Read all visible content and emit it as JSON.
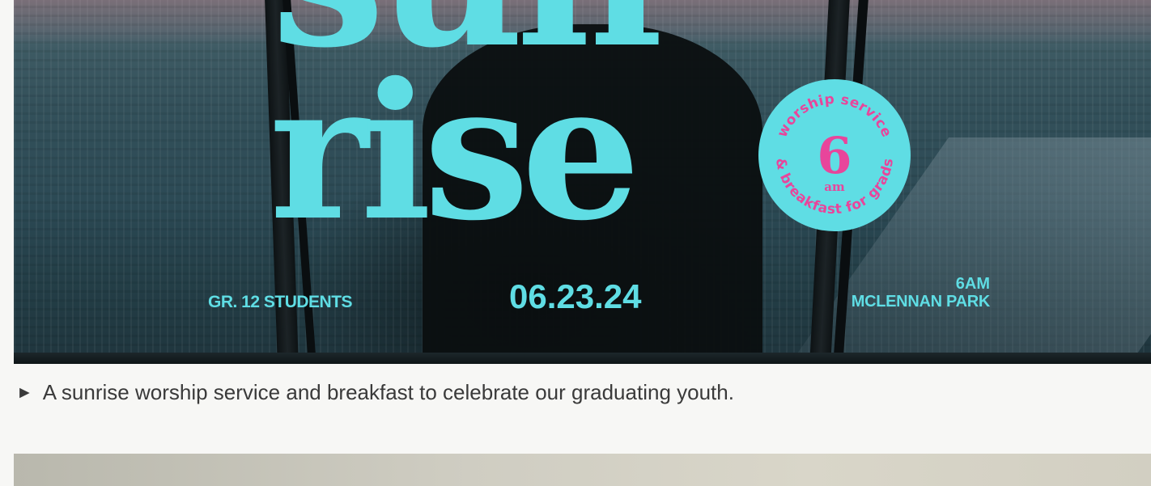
{
  "poster": {
    "headline_top": "sun",
    "headline_bottom": "rise",
    "badge": {
      "arc_top": "worship service",
      "arc_bottom": "& breakfast for grads",
      "number": "6",
      "unit": "am"
    },
    "left_label": "GR. 12 STUDENTS",
    "date": "06.23.24",
    "right_label_line1": "6AM",
    "right_label_line2": "MCLENNAN PARK"
  },
  "caption": {
    "arrow": "►",
    "text": "A sunrise worship service and breakfast to celebrate our graduating youth."
  },
  "colors": {
    "accent_cyan": "#5fdde4",
    "badge_text_pink": "#e8459b",
    "caption_text": "#3a3a3a",
    "page_background": "#f7f7f5"
  }
}
